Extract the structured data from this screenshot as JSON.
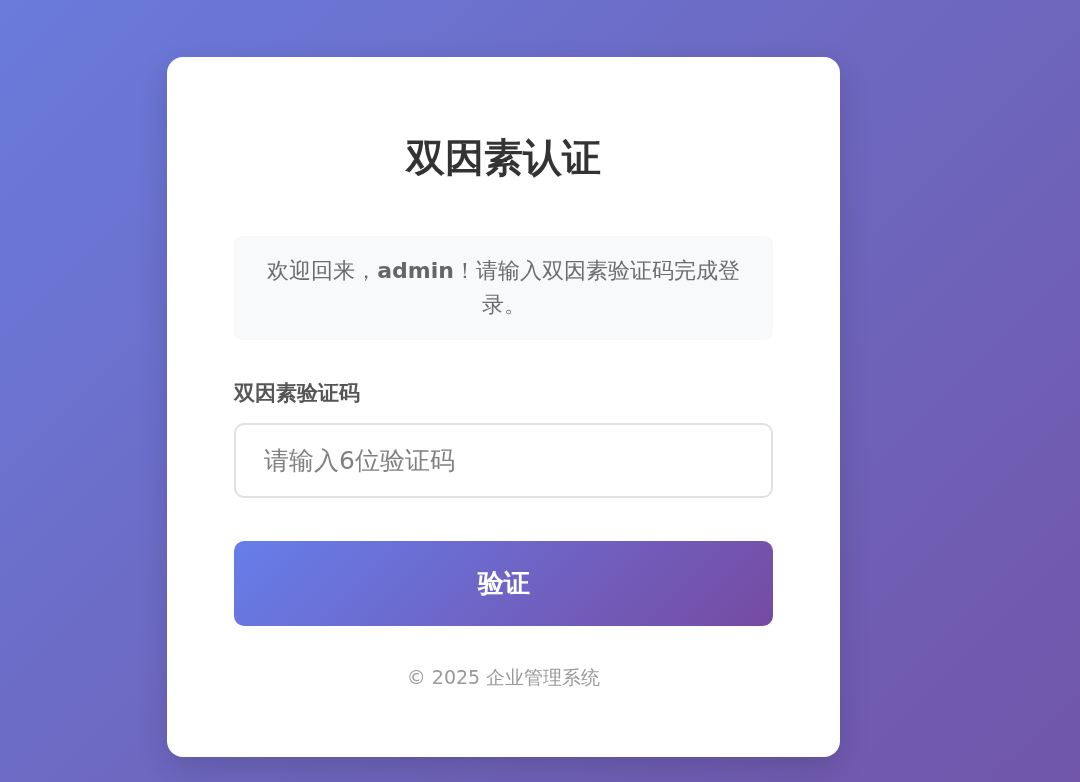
{
  "title": "双因素认证",
  "message": "欢迎回来，**admin**！请输入双因素验证码完成登录。",
  "field": {
    "label": "双因素验证码",
    "placeholder": "请输入6位验证码"
  },
  "submit_button": "验证",
  "footer": "© 2025 企业管理系统"
}
